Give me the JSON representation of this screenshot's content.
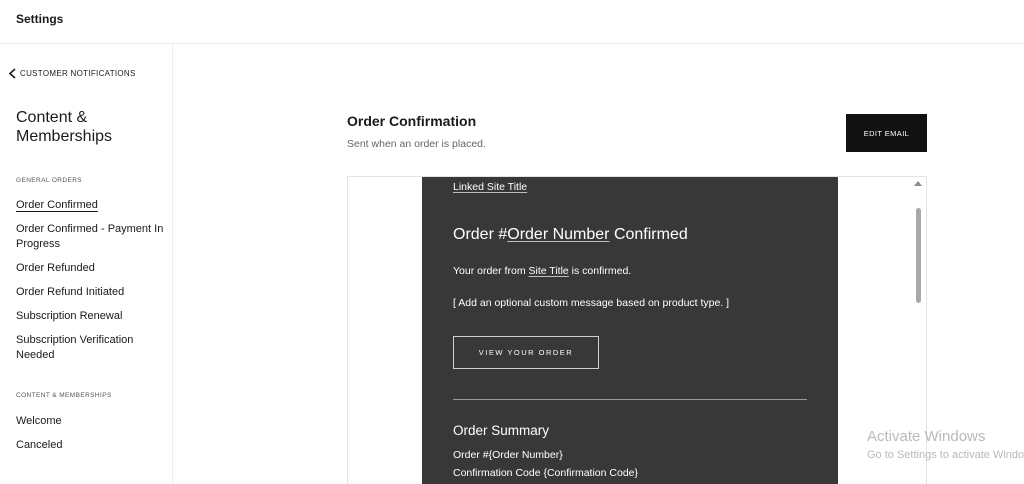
{
  "app": {
    "title": "Settings"
  },
  "sidebar": {
    "back_label": "CUSTOMER NOTIFICATIONS",
    "title": "Content & Memberships",
    "groups": [
      {
        "label": "GENERAL ORDERS",
        "items": [
          {
            "label": "Order Confirmed",
            "active": true
          },
          {
            "label": "Order Confirmed - Payment In Progress"
          },
          {
            "label": "Order Refunded"
          },
          {
            "label": "Order Refund Initiated"
          },
          {
            "label": "Subscription Renewal"
          },
          {
            "label": "Subscription Verification Needed"
          }
        ]
      },
      {
        "label": "CONTENT & MEMBERSHIPS",
        "items": [
          {
            "label": "Welcome"
          },
          {
            "label": "Canceled"
          }
        ]
      }
    ]
  },
  "main": {
    "title": "Order Confirmation",
    "subtitle": "Sent when an order is placed.",
    "edit_button": "EDIT EMAIL",
    "preview": {
      "site_link": "Linked Site Title",
      "heading_prefix": "Order #",
      "heading_link": "Order Number",
      "heading_suffix": " Confirmed",
      "order_text_prefix": "Your order from ",
      "order_text_link": "Site Title",
      "order_text_suffix": " is confirmed.",
      "custom_message": "[ Add an optional custom message based on product type. ]",
      "view_button": "VIEW YOUR ORDER",
      "summary_title": "Order Summary",
      "summary_order": "Order #{Order Number}",
      "summary_code": "Confirmation Code {Confirmation Code}"
    }
  },
  "watermark": {
    "line1": "Activate Windows",
    "line2": "Go to Settings to activate Windows."
  },
  "colors": {
    "email_bg": "#383838",
    "button_bg": "#111111",
    "text_dark": "#1a1a1a"
  }
}
